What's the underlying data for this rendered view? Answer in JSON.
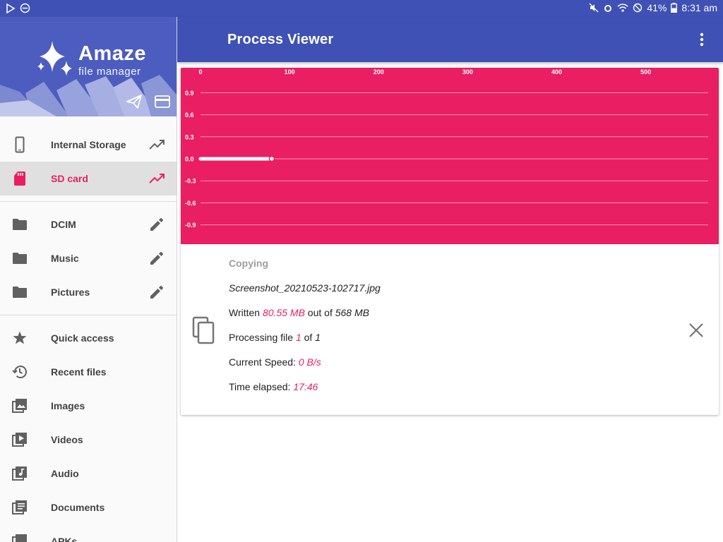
{
  "status_bar": {
    "battery_percent": "41%",
    "time": "8:31 am",
    "icons": [
      "play-store-icon",
      "do-not-disturb-icon",
      "mute-icon",
      "alarm-icon",
      "wifi-icon",
      "blocked-icon",
      "battery-icon"
    ]
  },
  "app_bar": {
    "title": "Process Viewer",
    "menu_icon": "more-vert-icon"
  },
  "drawer": {
    "brand_title": "Amaze",
    "brand_subtitle": "file manager",
    "header_buttons": [
      "send-icon",
      "credit-card-icon"
    ],
    "storage": [
      {
        "label": "Internal Storage",
        "icon": "phone-icon",
        "action_icon": "trending-up-icon",
        "active": false
      },
      {
        "label": "SD card",
        "icon": "sd-card-icon",
        "action_icon": "trending-up-icon",
        "active": true
      }
    ],
    "bookmarks": [
      {
        "label": "DCIM",
        "icon": "folder-icon",
        "action_icon": "edit-icon"
      },
      {
        "label": "Music",
        "icon": "folder-icon",
        "action_icon": "edit-icon"
      },
      {
        "label": "Pictures",
        "icon": "folder-icon",
        "action_icon": "edit-icon"
      }
    ],
    "quick": [
      {
        "label": "Quick access",
        "icon": "star-icon"
      },
      {
        "label": "Recent files",
        "icon": "history-icon"
      },
      {
        "label": "Images",
        "icon": "image-icon"
      },
      {
        "label": "Videos",
        "icon": "video-icon"
      },
      {
        "label": "Audio",
        "icon": "audio-icon"
      },
      {
        "label": "Documents",
        "icon": "document-icon"
      },
      {
        "label": "APKs",
        "icon": "apk-icon"
      }
    ]
  },
  "process": {
    "status": "Copying",
    "file_name": "Screenshot_20210523-102717.jpg",
    "written_prefix": "Written ",
    "written_value": "80.55 MB",
    "written_mid": " out of ",
    "written_total": "568 MB",
    "processing_prefix": "Processing file ",
    "processing_current": "1",
    "processing_mid": " of ",
    "processing_total": "1",
    "speed_prefix": "Current Speed: ",
    "speed_value": "0 B/s",
    "time_prefix": "Time elapsed: ",
    "time_value": "17:46"
  },
  "colors": {
    "primary": "#3f51b5",
    "accent": "#e91e63",
    "chart_bg": "#e91e63"
  },
  "chart_data": {
    "type": "line",
    "x_ticks": [
      "0",
      "100",
      "200",
      "300",
      "400",
      "500"
    ],
    "y_ticks": [
      "0.9",
      "0.6",
      "0.3",
      "0.0",
      "-0.3",
      "-0.6",
      "-0.9"
    ],
    "xlim": [
      0,
      570
    ],
    "ylim": [
      -1.0,
      1.0
    ],
    "grid": true,
    "series": [
      {
        "x": [
          0,
          10,
          20,
          30,
          40,
          50,
          60,
          70,
          80
        ],
        "y": [
          0,
          0,
          0,
          0,
          0,
          0,
          0,
          0,
          0
        ]
      }
    ]
  }
}
